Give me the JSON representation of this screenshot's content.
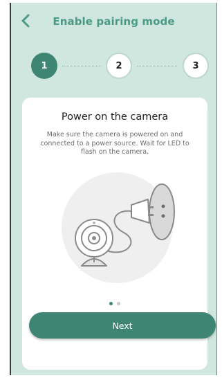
{
  "header": {
    "title": "Enable pairing mode",
    "back_icon": "chevron-left-icon"
  },
  "stepper": {
    "current_step": 1,
    "steps": [
      {
        "label": "1",
        "state": "active"
      },
      {
        "label": "2",
        "state": "inactive"
      },
      {
        "label": "3",
        "state": "inactive"
      }
    ]
  },
  "card": {
    "title": "Power on the camera",
    "description": "Make sure the camera is powered on and connected to a power source. Wait for LED to flash on the camera.",
    "illustration": "camera-plugged-into-wall-outlet-illustration"
  },
  "carousel": {
    "page_count": 2,
    "active_index": 0
  },
  "actions": {
    "next_label": "Next"
  },
  "colors": {
    "accent": "#3e8574",
    "title": "#4c9a86",
    "background": "#cfe7df",
    "card": "#ffffff"
  }
}
